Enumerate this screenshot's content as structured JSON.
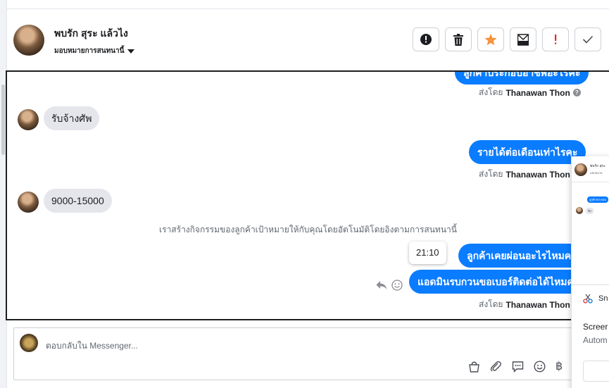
{
  "header": {
    "contact_name": "พบรัก สุระ แล้วไง",
    "assign_label": "มอบหมายการสนทนานี้",
    "actions": [
      {
        "name": "spam-button",
        "icon": "alert-circle-icon"
      },
      {
        "name": "delete-button",
        "icon": "trash-icon"
      },
      {
        "name": "star-button",
        "icon": "star-icon",
        "color": "#f7923b"
      },
      {
        "name": "move-to-inbox-button",
        "icon": "inbox-move-icon"
      },
      {
        "name": "follow-up-button",
        "icon": "exclamation-icon",
        "color": "#e4252c"
      },
      {
        "name": "mark-done-button",
        "icon": "checkmark-icon"
      }
    ]
  },
  "conversation": {
    "messages": [
      {
        "direction": "outgoing",
        "text": "ลูกค้าประกอบอาชีพอะไรคะ",
        "partially_visible": true
      },
      {
        "direction": "outgoing-meta",
        "sent_by_label": "ส่งโดย",
        "sent_by_name": "Thanawan Thon"
      },
      {
        "direction": "incoming",
        "text": "รับจ้างศัพ"
      },
      {
        "direction": "outgoing",
        "text": "รายได้ต่อเดือนเท่าไรคะ"
      },
      {
        "direction": "outgoing-meta",
        "sent_by_label": "ส่งโดย",
        "sent_by_name": "Thanawan Thon"
      },
      {
        "direction": "incoming",
        "text": "9000-15000"
      },
      {
        "direction": "system",
        "text": "เราสร้างกิจกรรมของลูกค้าเป้าหมายให้กับคุณโดยอัตโนมัติโดยอิงตามการสนทนานี้"
      },
      {
        "direction": "outgoing",
        "text": "ลูกค้าเคยผ่อนอะไรไหมคะ"
      },
      {
        "direction": "outgoing",
        "text": "แอดมินรบกวนขอเบอร์ติดต่อได้ไหมคะ"
      },
      {
        "direction": "outgoing-meta",
        "sent_by_label": "ส่งโดย",
        "sent_by_name": "Thanawan Thon"
      }
    ],
    "hover_time": "21:10"
  },
  "composer": {
    "placeholder": "ตอบกลับใน Messenger...",
    "tools": [
      "bag-icon",
      "paperclip-icon",
      "chat-bubble-icon",
      "smiley-icon",
      "baht-icon"
    ],
    "baht_symbol": "฿"
  },
  "overlay": {
    "mini_name": "พบรัก สุระ",
    "mini_sub": "มอบหมาย",
    "mini_out": "ลูกค้าประกอบ",
    "mini_in": "รับ",
    "snip_label": "Sn",
    "snip_text_line1": "Screer",
    "snip_text_line2": "Autom"
  },
  "colors": {
    "outgoing_bubble": "#0a7cff",
    "incoming_bubble": "#e4e6eb",
    "star": "#f7923b",
    "follow_up": "#e4252c"
  }
}
